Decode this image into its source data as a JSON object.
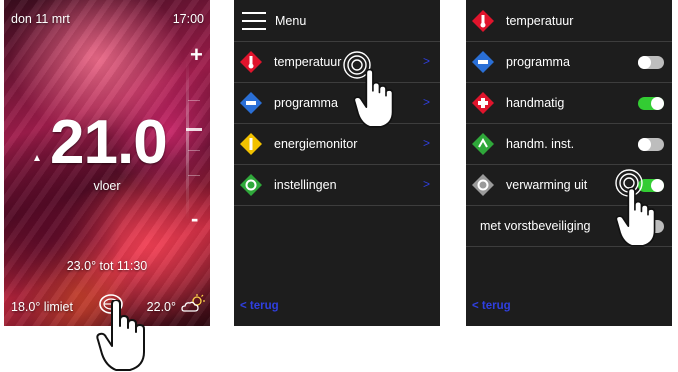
{
  "screen1": {
    "date": "don 11 mrt",
    "time": "17:00",
    "temperature": "21.0",
    "sensor": "vloer",
    "schedule": "23.0° tot 11:30",
    "limit": "18.0° limiet",
    "outside_temp": "22.0°",
    "plus_label": "+",
    "minus_label": "-"
  },
  "screen2": {
    "title": "Menu",
    "items": [
      {
        "label": "temperatuur",
        "icon": "thermometer-icon",
        "color": "#e0142c"
      },
      {
        "label": "programma",
        "icon": "program-icon",
        "color": "#2a6fd6"
      },
      {
        "label": "energiemonitor",
        "icon": "energy-icon",
        "color": "#f2c200"
      },
      {
        "label": "instellingen",
        "icon": "settings-icon",
        "color": "#2fa83a"
      }
    ],
    "chevron": ">",
    "back": "< terug"
  },
  "screen3": {
    "items": [
      {
        "label": "temperatuur",
        "icon": "thermometer-icon",
        "color": "#e0142c"
      },
      {
        "label": "programma",
        "icon": "program-icon",
        "color": "#2a6fd6",
        "toggle": "off"
      },
      {
        "label": "handmatig",
        "icon": "manual-icon",
        "color": "#e0142c",
        "toggle": "on"
      },
      {
        "label": "handm. inst.",
        "icon": "manual-settings-icon",
        "color": "#2fa83a",
        "toggle": "off"
      },
      {
        "label": "verwarming uit",
        "icon": "heating-off-icon",
        "color": "#9a9a9a",
        "toggle": "on"
      },
      {
        "label": "met vorstbeveiliging",
        "toggle": "off"
      }
    ],
    "back": "< terug"
  },
  "colors": {
    "accent_blue": "#2f3fe0",
    "toggle_on": "#33cc33",
    "toggle_off": "#bdbdbd",
    "panel_bg": "#1d1d1d"
  }
}
